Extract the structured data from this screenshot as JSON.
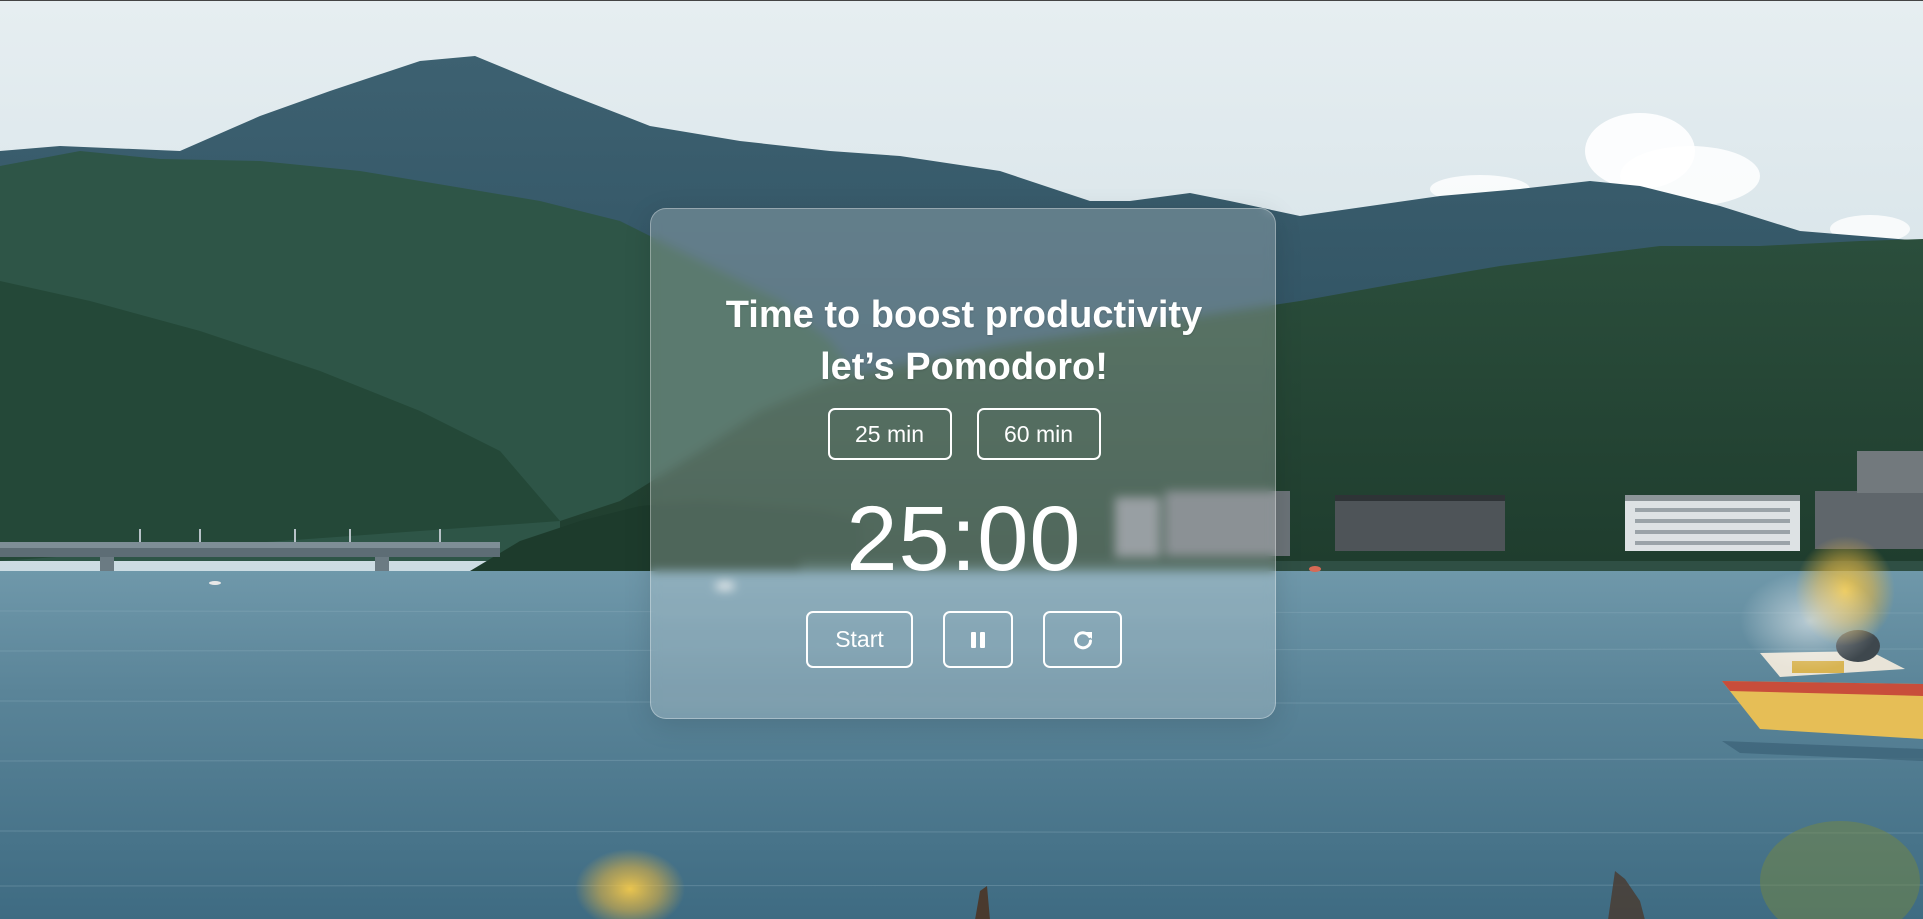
{
  "card": {
    "headline_line1": "Time to boost productivity",
    "headline_line2": "let’s Pomodoro!"
  },
  "presets": [
    {
      "label": "25 min"
    },
    {
      "label": "60 min"
    }
  ],
  "timer": {
    "display": "25:00"
  },
  "controls": {
    "start_label": "Start",
    "pause_icon": "pause-icon",
    "reset_icon": "reset-icon"
  },
  "colors": {
    "text": "#ffffff",
    "card_fill": "rgba(255,255,255,0.22)",
    "sky": "#dfe8ec",
    "mountains": "#2c4f60",
    "forest": "#17361f",
    "lake": "#4f7f94"
  },
  "background": {
    "scene": "mountain lake with forested hills, bridge, hotels and a yellow boat"
  }
}
